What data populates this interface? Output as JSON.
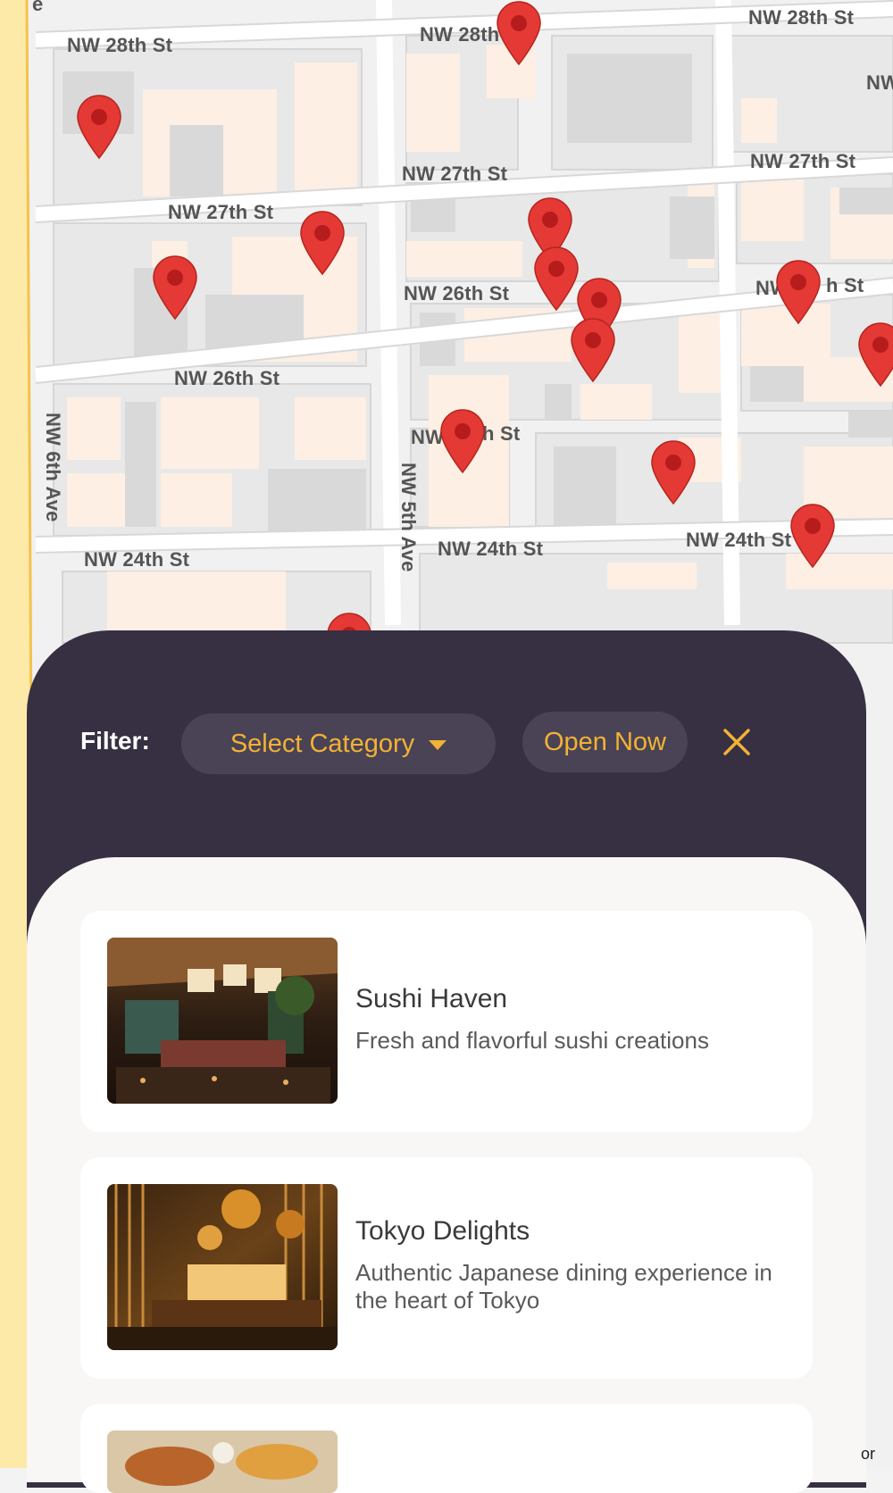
{
  "map": {
    "street_labels": {
      "nw28_left": "NW 28th St",
      "nw28_mid": "NW 28th",
      "nw28_right": "NW 28th St",
      "nw_edge": "NW",
      "nw27_left": "NW 27th St",
      "nw27_mid": "NW 27th St",
      "nw27_right": "NW 27th St",
      "nw26_left": "NW 26th St",
      "nw26_mid": "NW 26th St",
      "nw26_right_a": "NW",
      "nw26_right_b": "h St",
      "nw25_a": "NW",
      "nw25_b": "h St",
      "nw24_left": "NW 24th St",
      "nw24_mid": "NW 24th St",
      "nw24_right": "NW 24th St",
      "ave6": "NW 6th Ave",
      "ave5": "NW 5th Ave",
      "edge_e": "e"
    },
    "pin_color": "#e53935",
    "pin_dot_color": "#b71c1c",
    "attribution": "or"
  },
  "filter": {
    "label": "Filter:",
    "category_placeholder": "Select Category",
    "open_now": "Open Now",
    "accent": "#f2b233",
    "sheet_color": "#372f42"
  },
  "restaurants": [
    {
      "name": "Sushi Haven",
      "description": "Fresh and flavorful sushi creations"
    },
    {
      "name": "Tokyo Delights",
      "description": "Authentic Japanese dining experience in the heart of Tokyo"
    }
  ]
}
